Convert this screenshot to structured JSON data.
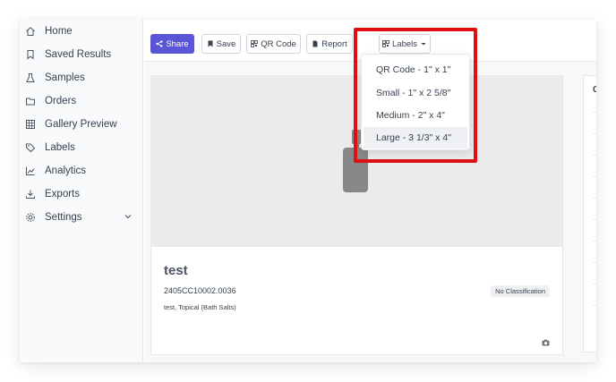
{
  "sidebar": {
    "items": [
      {
        "label": "Home",
        "icon": "home-icon"
      },
      {
        "label": "Saved Results",
        "icon": "bookmark-icon"
      },
      {
        "label": "Samples",
        "icon": "flask-icon"
      },
      {
        "label": "Orders",
        "icon": "folder-icon"
      },
      {
        "label": "Gallery Preview",
        "icon": "grid-icon"
      },
      {
        "label": "Labels",
        "icon": "tags-icon"
      },
      {
        "label": "Analytics",
        "icon": "chart-icon"
      },
      {
        "label": "Exports",
        "icon": "download-icon"
      },
      {
        "label": "Settings",
        "icon": "gear-icon"
      }
    ]
  },
  "toolbar": {
    "share_label": "Share",
    "save_label": "Save",
    "qr_label": "QR Code",
    "report_label": "Report",
    "labels_label": "Labels",
    "primary_color": "#5a55d6"
  },
  "labels_menu": {
    "options": [
      "QR Code - 1\" x 1\"",
      "Small - 1\" x 2 5/8\"",
      "Medium - 2\" x 4\"",
      "Large - 3 1/3\" x 4\""
    ],
    "highlighted_option": "Large - 3 1/3\" x 4\"",
    "highlight_color": "#dd1111"
  },
  "sample": {
    "title": "test",
    "id": "2405CC10002.0036",
    "description": "test, Topical (Bath Salts)",
    "classification": "No Classification"
  },
  "side_panel": {
    "letter": "C"
  }
}
